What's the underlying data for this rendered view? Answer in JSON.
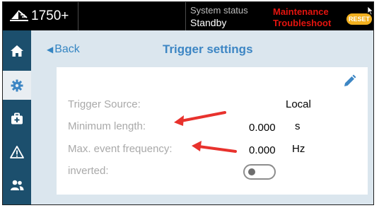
{
  "header": {
    "model": "1750+",
    "system_status_label": "System status",
    "system_status_value": "Standby",
    "maintenance_label": "Maintenance",
    "troubleshoot_label": "Troubleshoot",
    "reset_label": "RESET"
  },
  "sidebar": {
    "items": [
      {
        "icon": "home-icon",
        "active": false
      },
      {
        "icon": "gear-icon",
        "active": true
      },
      {
        "icon": "toolbox-icon",
        "active": false
      },
      {
        "icon": "warning-icon",
        "active": false
      },
      {
        "icon": "users-icon",
        "active": false
      }
    ]
  },
  "page": {
    "back_label": "Back",
    "title": "Trigger settings"
  },
  "settings": {
    "trigger_source_label": "Trigger Source:",
    "trigger_source_value": "Local",
    "min_length_label": "Minimum length:",
    "min_length_value": "0.000",
    "min_length_unit": "s",
    "max_freq_label": "Max. event frequency:",
    "max_freq_value": "0.000",
    "max_freq_unit": "Hz",
    "inverted_label": "inverted:",
    "inverted_on": false
  },
  "colors": {
    "accent": "#3d86c4",
    "sidebar": "#1c4f6d",
    "reset": "#f2b01e",
    "alert": "#e4140f",
    "annotation_arrow": "#e8322d"
  }
}
